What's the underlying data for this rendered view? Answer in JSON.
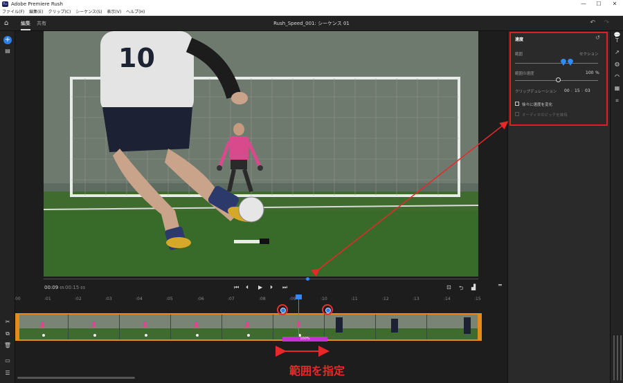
{
  "window": {
    "title": "Adobe Premiere Rush",
    "logo_text": "Ru",
    "controls": [
      "—",
      "☐",
      "✕"
    ]
  },
  "menu": [
    "ファイル(F)",
    "編集(E)",
    "クリップ(C)",
    "シーケンス(S)",
    "表示(V)",
    "ヘルプ(H)"
  ],
  "appbar": {
    "tabs": [
      {
        "label": "編集",
        "active": true
      },
      {
        "label": "共有",
        "active": false
      }
    ],
    "sequence_title": "Rush_Speed_001: シーケンス 01",
    "undo_icon": "↶",
    "redo_icon": "↷"
  },
  "player": {
    "current_time": "00:09",
    "current_frames": "05",
    "total_time": "00:15",
    "total_frames": "03",
    "progress": 0.605
  },
  "timeline": {
    "ticks": [
      "00",
      ":01",
      ":02",
      ":03",
      ":04",
      ":05",
      ":06",
      ":07",
      ":08",
      ":09",
      ":10",
      ":11",
      ":12",
      ":13",
      ":14",
      ":15"
    ],
    "range_label": "100%"
  },
  "speed_panel": {
    "title": "速度",
    "range_label": "範囲",
    "section_label": "セクション",
    "range_speed_label": "範囲の速度",
    "range_speed_value": "100",
    "range_speed_unit": "%",
    "clip_duration_label": "クリップデュレーション",
    "duration_h": "00",
    "duration_m": "15",
    "duration_s": "03",
    "ramp_label": "徐々に速度を変化",
    "pitch_label": "オーディオのピッチを維持"
  },
  "annotation": {
    "text": "範囲を指定",
    "color": "#e82828"
  },
  "colors": {
    "accent": "#2d8cff",
    "clip_border": "#e38b1b",
    "range_bar": "#c82fd6",
    "highlight": "#e02020"
  }
}
